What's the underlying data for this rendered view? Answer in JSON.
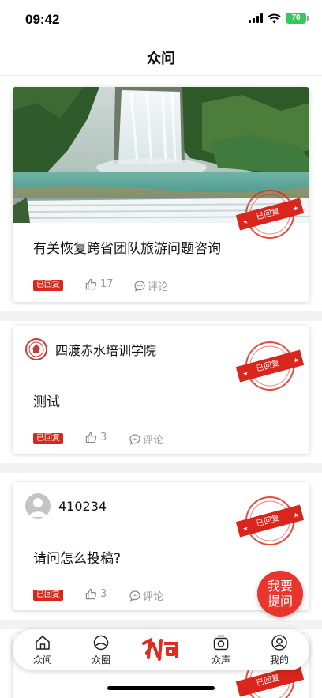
{
  "status_bar": {
    "time": "09:42",
    "battery": "70"
  },
  "nav": {
    "title": "众问"
  },
  "posts": [
    {
      "title": "有关恢复跨省团队旅游问题咨询",
      "status": "已回复",
      "likes": "17",
      "comment_label": "评论",
      "stamp_text": "已回复"
    },
    {
      "author": "四渡赤水培训学院",
      "title": "测试",
      "status": "已回复",
      "likes": "3",
      "comment_label": "评论",
      "stamp_text": "已回复"
    },
    {
      "author": "410234",
      "title": "请问怎么投稿?",
      "status": "已回复",
      "likes": "3",
      "comment_label": "评论",
      "stamp_text": "已回复"
    }
  ],
  "partial_stamp": "已回复",
  "ask_button": {
    "line1": "我要",
    "line2": "提问"
  },
  "tabs": [
    {
      "label": "众闻",
      "icon": "home-icon"
    },
    {
      "label": "众圈",
      "icon": "circle-icon"
    },
    {
      "label": "众问",
      "icon": "zhongwen-logo-icon"
    },
    {
      "label": "众声",
      "icon": "camera-icon"
    },
    {
      "label": "我的",
      "icon": "profile-icon"
    }
  ],
  "colors": {
    "accent": "#e8362f",
    "tag": "#d9271c",
    "battery": "#34c759",
    "muted": "#999999"
  }
}
